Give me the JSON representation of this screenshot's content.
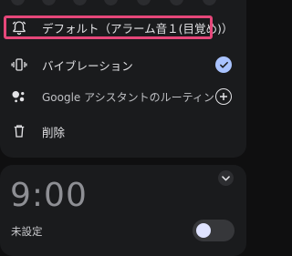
{
  "alarm_options": {
    "ringtone_label": "デフォルト（アラーム音１(目覚め)）",
    "vibration_label": "バイブレーション",
    "vibration_checked": true,
    "assistant_label": "Google アシスタントのルーティン",
    "delete_label": "削除"
  },
  "next_alarm": {
    "time": "9:00",
    "status": "未設定",
    "enabled": false
  },
  "colors": {
    "highlight": "#e6477a",
    "accent": "#a9c3ff"
  }
}
